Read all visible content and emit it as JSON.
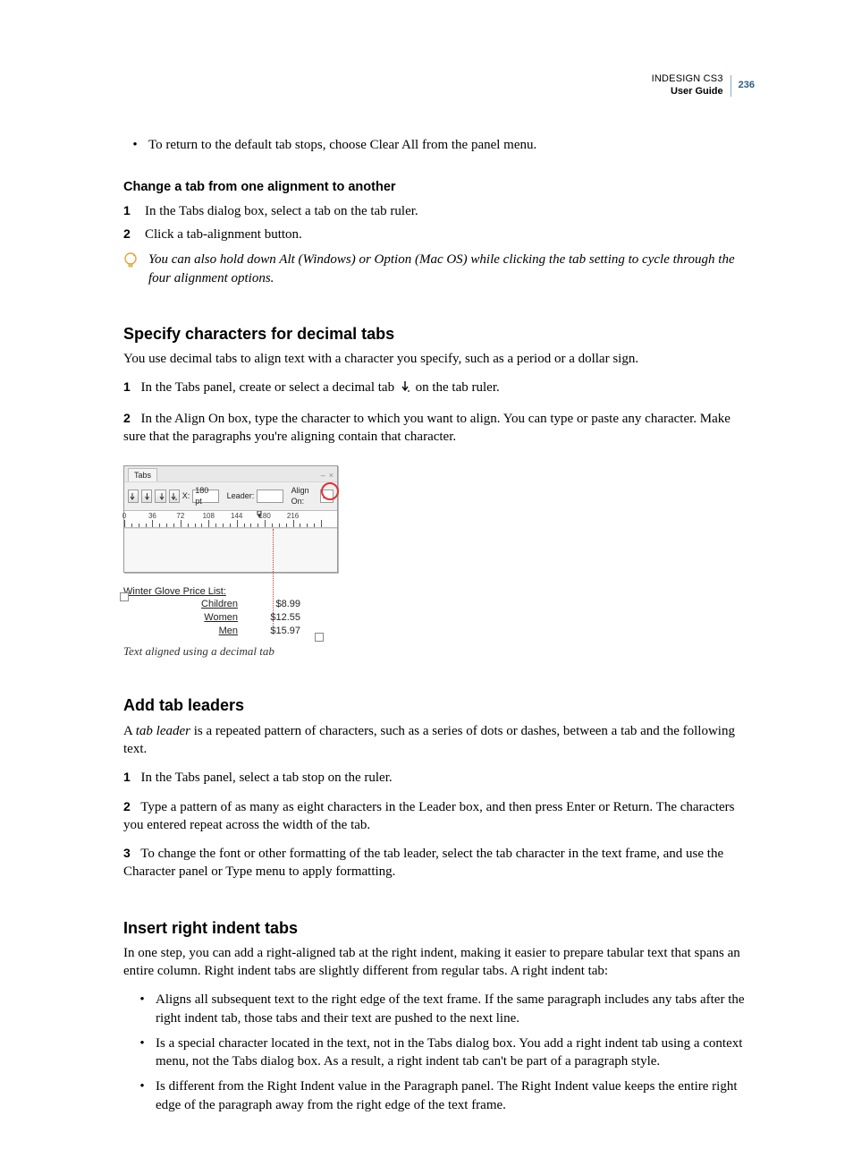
{
  "header": {
    "product_title": "INDESIGN CS3",
    "doc_title": "User Guide",
    "page_number": "236"
  },
  "preamble_bullet": "To return to the default tab stops, choose Clear All from the panel menu.",
  "task_change_alignment": {
    "title": "Change a tab from one alignment to another",
    "steps": [
      "In the Tabs dialog box, select a tab on the tab ruler.",
      "Click a tab-alignment button."
    ],
    "tip": "You can also hold down Alt (Windows) or Option (Mac OS) while clicking the tab setting to cycle through the four alignment options."
  },
  "section_decimal": {
    "title": "Specify characters for decimal tabs",
    "intro": "You use decimal tabs to align text with a character you specify, such as a period or a dollar sign.",
    "step1_before": "In the Tabs panel, create or select a decimal tab ",
    "step1_after": " on the tab ruler.",
    "step2": "In the Align On box, type the character to which you want to align. You can type or paste any character. Make sure that the paragraphs you're aligning contain that character.",
    "figure": {
      "panel_tab_label": "Tabs",
      "x_label": "X:",
      "x_value": "180 pt",
      "leader_label": "Leader:",
      "leader_value": "",
      "align_on_label": "Align On:",
      "align_on_value": ".",
      "ruler_numbers": [
        "0",
        "36",
        "72",
        "108",
        "144",
        "180",
        "216"
      ],
      "example_title": "Winter Glove Price List:",
      "example_rows": [
        {
          "label": "Children",
          "value": "$8.99"
        },
        {
          "label": "Women",
          "value": "$12.55"
        },
        {
          "label": "Men",
          "value": "$15.97"
        }
      ],
      "caption": "Text aligned using a decimal tab"
    }
  },
  "section_leaders": {
    "title": "Add tab leaders",
    "intro_before": "A ",
    "intro_em": "tab leader",
    "intro_after": " is a repeated pattern of characters, such as a series of dots or dashes, between a tab and the following text.",
    "steps": [
      "In the Tabs panel, select a tab stop on the ruler.",
      "Type a pattern of as many as eight characters in the Leader box, and then press Enter or Return. The characters you entered repeat across the width of the tab.",
      "To change the font or other formatting of the tab leader, select the tab character in the text frame, and use the Character panel or Type menu to apply formatting."
    ]
  },
  "section_right_indent": {
    "title": "Insert right indent tabs",
    "intro": "In one step, you can add a right-aligned tab at the right indent, making it easier to prepare tabular text that spans an entire column. Right indent tabs are slightly different from regular tabs. A right indent tab:",
    "bullets": [
      "Aligns all subsequent text to the right edge of the text frame. If the same paragraph includes any tabs after the right indent tab, those tabs and their text are pushed to the next line.",
      "Is a special character located in the text, not in the Tabs dialog box. You add a right indent tab using a context menu, not the Tabs dialog box. As a result, a right indent tab can't be part of a paragraph style.",
      "Is different from the Right Indent value in the Paragraph panel. The Right Indent value keeps the entire right edge of the paragraph away from the right edge of the text frame."
    ]
  }
}
